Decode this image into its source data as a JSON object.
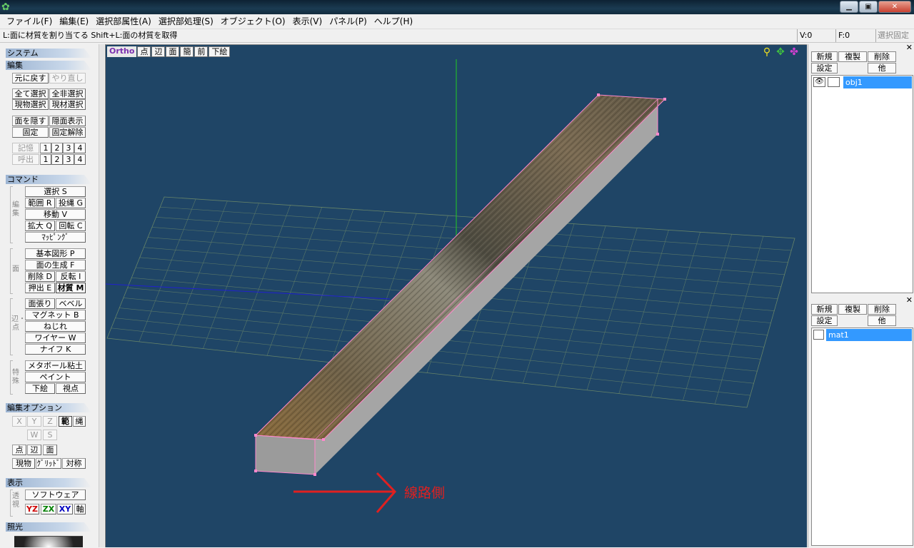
{
  "menu": [
    "ファイル(F)",
    "編集(E)",
    "選択部属性(A)",
    "選択部処理(S)",
    "オブジェクト(O)",
    "表示(V)",
    "パネル(P)",
    "ヘルプ(H)"
  ],
  "status": {
    "hint": "L:面に材質を割り当てる  Shift+L:面の材質を取得",
    "v": "V:0",
    "f": "F:0",
    "lock": "選択固定"
  },
  "sections": {
    "system": "システム",
    "edit": "編集",
    "command": "コマンド",
    "edit_option": "編集オプション",
    "display": "表示",
    "lighting": "照光"
  },
  "edit": {
    "undo": "元に戻す",
    "redo": "やり直し",
    "select_all": "全て選択",
    "select_none": "全非選択",
    "select_obj": "現物選択",
    "select_mat": "現材選択",
    "hide_face": "面を隠す",
    "show_hidden": "隠面表示",
    "fix": "固定",
    "unfix": "固定解除",
    "memory": "記憶",
    "recall": "呼出",
    "slots": [
      "1",
      "2",
      "3",
      "4"
    ]
  },
  "command": {
    "select": "選択 S",
    "range": "範囲 R",
    "lasso": "投縄 G",
    "move": "移動 V",
    "scale": "拡大 Q",
    "rotate": "回転 C",
    "mapping": "ﾏｯﾋﾟﾝｸﾞ",
    "group_edit": "編集",
    "primitive": "基本図形 P",
    "face_gen": "面の生成 F",
    "delete": "削除 D",
    "flip": "反転 I",
    "extrude": "押出 E",
    "material": "材質 M",
    "group_face": "面",
    "knife_face": "面張り",
    "bevel": "ベベル",
    "magnet": "マグネット B",
    "twist": "ねじれ",
    "wire": "ワイヤー W",
    "knife": "ナイフ K",
    "group_edge": "辺・点",
    "metaball": "メタボール粘土",
    "paint": "ペイント",
    "underlay": "下絵",
    "viewpoint": "視点",
    "group_special": "特殊"
  },
  "edit_option": {
    "x": "X",
    "y": "Y",
    "z": "Z",
    "range": "範",
    "lasso": "縄",
    "w": "W",
    "s": "S",
    "vertex": "点",
    "edge": "辺",
    "face": "面",
    "current": "現物",
    "grid": "ｸﾞﾘｯﾄﾞ",
    "symmetry": "対称"
  },
  "display": {
    "software": "ソフトウェア",
    "group": "透視",
    "yz": "YZ",
    "zx": "ZX",
    "xy": "XY",
    "axis": "軸"
  },
  "viewport": {
    "ortho": "Ortho",
    "tabs": [
      "点",
      "辺",
      "面",
      "簡",
      "前",
      "下絵"
    ],
    "annotation": "線路側"
  },
  "objects": {
    "new": "新規",
    "copy": "複製",
    "delete": "削除",
    "settings": "設定",
    "other": "他",
    "items": [
      "obj1"
    ]
  },
  "materials": {
    "new": "新規",
    "copy": "複製",
    "delete": "削除",
    "settings": "設定",
    "other": "他",
    "items": [
      "mat1"
    ]
  },
  "colors": {
    "viewport_bg": "#1f4566",
    "selection": "#3399ff",
    "edge_highlight": "#ff88cc",
    "arrow": "#e02020"
  }
}
